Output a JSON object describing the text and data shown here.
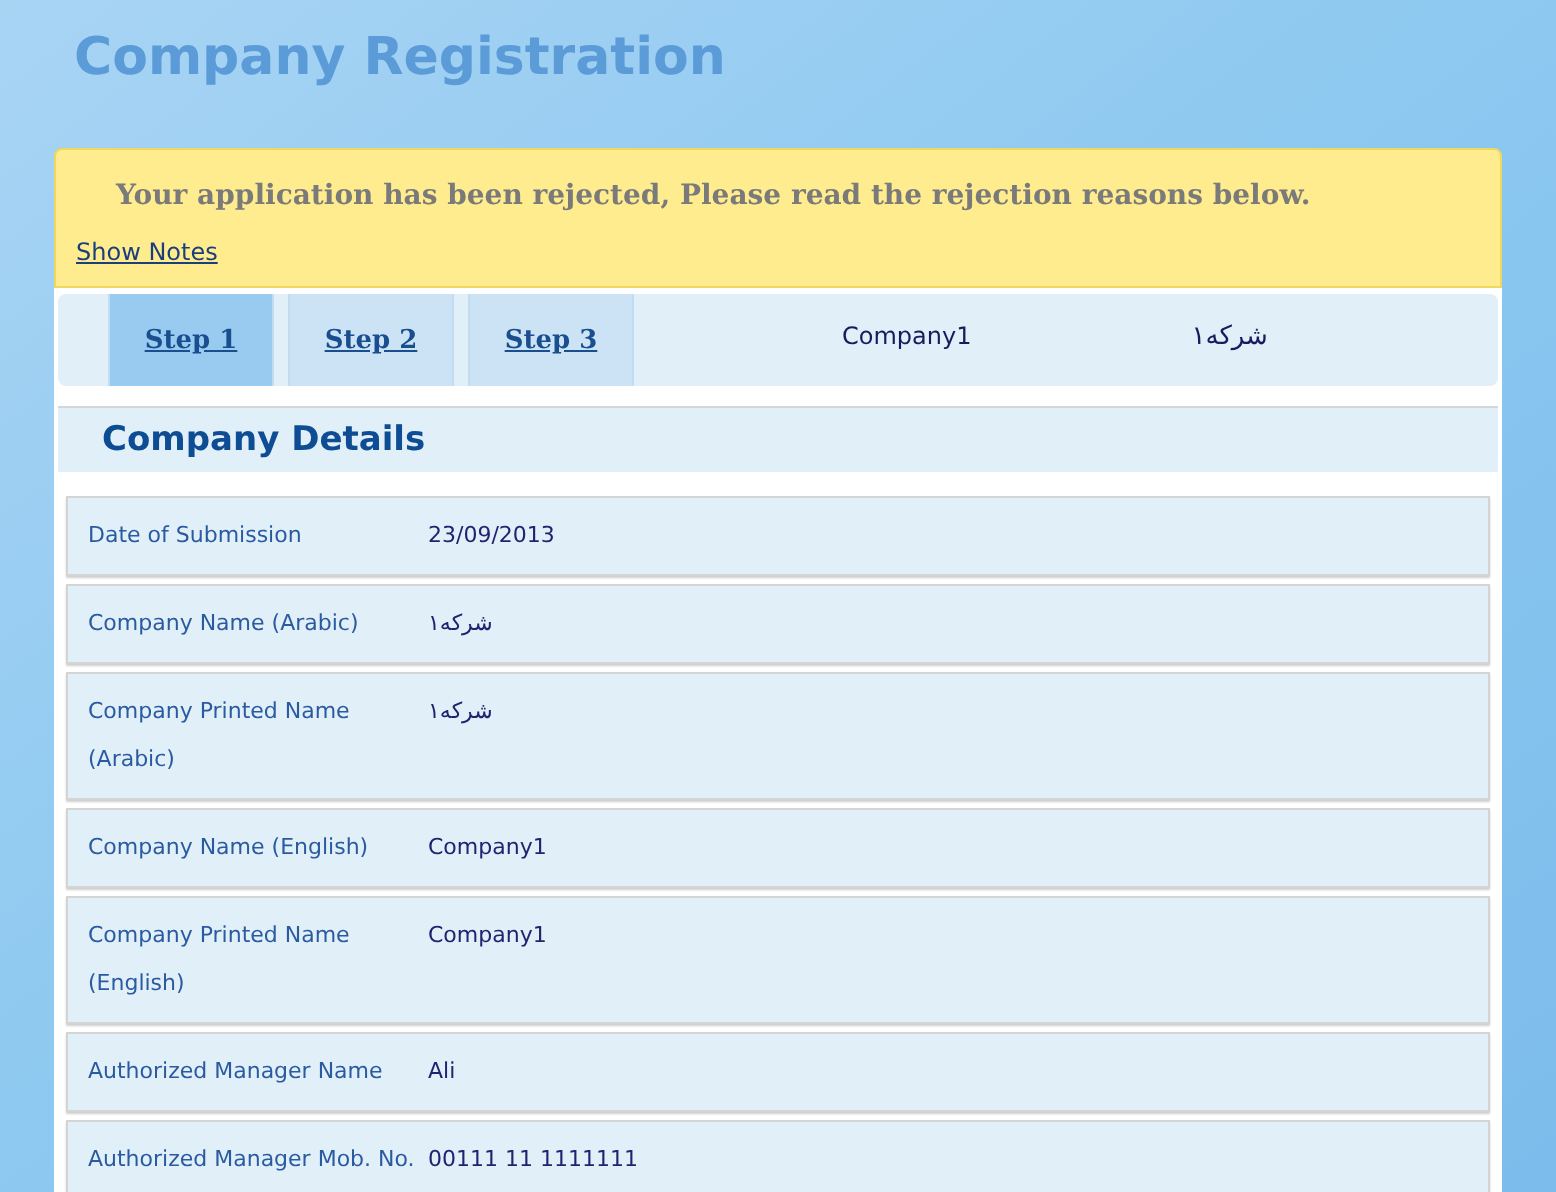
{
  "page_title": "Company Registration",
  "alert": {
    "message": "Your application has been rejected, Please read the rejection reasons below.",
    "link": "Show Notes"
  },
  "steps": [
    {
      "label": "Step 1",
      "selected": true
    },
    {
      "label": "Step 2",
      "selected": false
    },
    {
      "label": "Step 3",
      "selected": false
    }
  ],
  "step_info": [
    "Company1",
    "شركه١"
  ],
  "section_title": "Company Details",
  "fields": [
    {
      "label": "Date of Submission",
      "value": "23/09/2013"
    },
    {
      "label": "Company Name (Arabic)",
      "value": "شركه١"
    },
    {
      "label": "Company Printed Name (Arabic)",
      "value": "شركه١"
    },
    {
      "label": "Company Name (English)",
      "value": "Company1"
    },
    {
      "label": "Company Printed Name (English)",
      "value": "Company1"
    },
    {
      "label": "Authorized Manager Name",
      "value": "Ali"
    },
    {
      "label": "Authorized Manager Mob. No.",
      "value": "00111 11 1111111"
    }
  ]
}
